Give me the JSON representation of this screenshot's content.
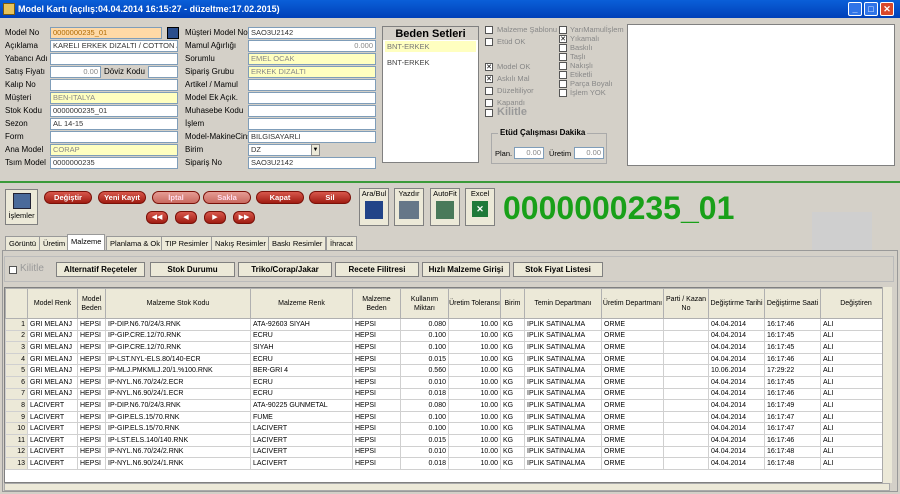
{
  "window": {
    "title": "Model Kartı (açılış:04.04.2014 16:15:27 - düzeltme:17.02.2015)"
  },
  "left_fields": [
    {
      "label": "Model No",
      "value": "0000000235_01",
      "style": "o"
    },
    {
      "label": "Açıklama",
      "value": "KARELI ERKEK DIZALTI / COTTON /",
      "style": "w"
    },
    {
      "label": "Yabancı Adı",
      "value": "",
      "style": "w"
    },
    {
      "label": "Satış Fiyatı",
      "value": "0.00",
      "style": "r"
    },
    {
      "label": "Kalıp No",
      "value": "",
      "style": "w"
    },
    {
      "label": "Müşteri",
      "value": "BEN-ITALYA",
      "style": "y"
    },
    {
      "label": "Stok Kodu",
      "value": "0000000235_01",
      "style": "w"
    },
    {
      "label": "Sezon",
      "value": "AL 14-15",
      "style": "w"
    },
    {
      "label": "Form",
      "value": "",
      "style": "w"
    },
    {
      "label": "Ana Model",
      "value": "CORAP",
      "style": "y"
    },
    {
      "label": "Tsım Model",
      "value": "0000000235",
      "style": "w"
    }
  ],
  "doviz_kodu_label": "Döviz Kodu",
  "mid_fields": [
    {
      "label": "Müşteri Model No",
      "value": "SAO3U2142",
      "style": "w"
    },
    {
      "label": "Mamul Ağırlığı",
      "value": "0.000",
      "style": "r"
    },
    {
      "label": "Sorumlu",
      "value": "EMEL OCAK",
      "style": "y"
    },
    {
      "label": "Sipariş Grubu",
      "value": "ERKEK DIZALTI",
      "style": "y"
    },
    {
      "label": "Artikel / Mamul",
      "value": "",
      "style": "w"
    },
    {
      "label": "Model Ek Açık.",
      "value": "",
      "style": "w"
    },
    {
      "label": "Muhasebe Kodu",
      "value": "",
      "style": "w"
    },
    {
      "label": "İşlem",
      "value": "",
      "style": "w"
    },
    {
      "label": "Model-MakineCinsi",
      "value": "BILGISAYARLI",
      "style": "w"
    },
    {
      "label": "Birim",
      "value": "DZ",
      "style": "w"
    },
    {
      "label": "Sipariş No",
      "value": "SAO3U2142",
      "style": "w"
    }
  ],
  "beden": {
    "title": "Beden Setleri",
    "selected": "BNT-ERKEK",
    "items": [
      "BNT-ERKEK"
    ]
  },
  "checks_left": [
    {
      "label": "Malzeme Şablonu",
      "checked": false
    },
    {
      "label": "Etüd OK",
      "checked": false
    },
    {
      "label": "Model OK",
      "checked": true
    },
    {
      "label": "Askılı Mal",
      "checked": true
    },
    {
      "label": "Düzeltiliyor",
      "checked": false
    },
    {
      "label": "Kapandı",
      "checked": false
    }
  ],
  "kilitle_label": "Kilitle",
  "checks_right": [
    {
      "label": "YarıMamulİşlem",
      "checked": false
    },
    {
      "label": "Yıkamalı",
      "checked": true
    },
    {
      "label": "Baskılı",
      "checked": false
    },
    {
      "label": "Taşlı",
      "checked": false
    },
    {
      "label": "Nakışlı",
      "checked": false
    },
    {
      "label": "Etiketli",
      "checked": false
    },
    {
      "label": "Parça Boyalı",
      "checked": false
    },
    {
      "label": "İşlem YOK",
      "checked": false
    }
  ],
  "etud": {
    "title": "Etüd Çalışması Dakika",
    "plan_label": "Plan.",
    "plan_value": "0.00",
    "uretim_label": "Üretim",
    "uretim_value": "0.00"
  },
  "toolbar": {
    "islemler": "İşlemler",
    "buttons": [
      "Değiştir",
      "Yeni Kayıt",
      "İptal",
      "Sakla",
      "Kapat",
      "Sil"
    ],
    "nav": [
      "◀◀",
      "◀",
      "▶",
      "▶▶"
    ],
    "ara_bul": "Ara/Bul",
    "yazdir": "Yazdır",
    "autofit": "AutoFit",
    "excel": "Excel"
  },
  "big_code": "0000000235_01",
  "tabs": [
    "Görüntü",
    "Üretim",
    "Malzeme",
    "Planlama & Ok",
    "TIP Resimler",
    "Nakış Resimler",
    "Baskı Resimler",
    "İhracat"
  ],
  "active_tab": "Malzeme",
  "sub_buttons": [
    "Alternatif Reçeteler",
    "Stok Durumu",
    "Triko/Corap/Jakar",
    "Recete Filitresi",
    "Hızlı Malzeme Girişi",
    "Stok Fiyat Listesi"
  ],
  "sub_kilitle": "Kilitle",
  "grid": {
    "columns": [
      "",
      "Model Renk",
      "Model Beden",
      "Malzeme Stok Kodu",
      "Malzeme Renk",
      "Malzeme Beden",
      "Kullanım Miktarı",
      "Üretim Toleransı",
      "Birim",
      "Temin Departmanı",
      "Üretim Departmanı",
      "Parti / Kazan No",
      "Değiştirme Tarihi",
      "Değiştirme Saati",
      "Değiştiren"
    ],
    "rows": [
      [
        "1",
        "GRI MELANJ",
        "HEPSI",
        "IP-DIP.N6.70/24/3.RNK",
        "ATA-92603 SIYAH",
        "HEPSI",
        "0.080",
        "10.00",
        "KG",
        "IPLIK SATINALMA",
        "ORME",
        "",
        "04.04.2014",
        "16:17:46",
        "ALI"
      ],
      [
        "2",
        "GRI MELANJ",
        "HEPSI",
        "IP-GIP.CRE.12/70.RNK",
        "ECRU",
        "HEPSI",
        "0.100",
        "10.00",
        "KG",
        "IPLIK SATINALMA",
        "ORME",
        "",
        "04.04.2014",
        "16:17:45",
        "ALI"
      ],
      [
        "3",
        "GRI MELANJ",
        "HEPSI",
        "IP-GIP.CRE.12/70.RNK",
        "SIYAH",
        "HEPSI",
        "0.100",
        "10.00",
        "KG",
        "IPLIK SATINALMA",
        "ORME",
        "",
        "04.04.2014",
        "16:17:45",
        "ALI"
      ],
      [
        "4",
        "GRI MELANJ",
        "HEPSI",
        "IP-LST.NYL-ELS.80/140-ECR",
        "ECRU",
        "HEPSI",
        "0.015",
        "10.00",
        "KG",
        "IPLIK SATINALMA",
        "ORME",
        "",
        "04.04.2014",
        "16:17:46",
        "ALI"
      ],
      [
        "5",
        "GRI MELANJ",
        "HEPSI",
        "IP-MLJ.PMKMLJ.20/1.%100.RNK",
        "BER-GRI 4",
        "HEPSI",
        "0.560",
        "10.00",
        "KG",
        "IPLIK SATINALMA",
        "ORME",
        "",
        "10.06.2014",
        "17:29:22",
        "ALI"
      ],
      [
        "6",
        "GRI MELANJ",
        "HEPSI",
        "IP-NYL.N6.70/24/2.ECR",
        "ECRU",
        "HEPSI",
        "0.010",
        "10.00",
        "KG",
        "IPLIK SATINALMA",
        "ORME",
        "",
        "04.04.2014",
        "16:17:45",
        "ALI"
      ],
      [
        "7",
        "GRI MELANJ",
        "HEPSI",
        "IP-NYL.N6.90/24/1.ECR",
        "ECRU",
        "HEPSI",
        "0.018",
        "10.00",
        "KG",
        "IPLIK SATINALMA",
        "ORME",
        "",
        "04.04.2014",
        "16:17:46",
        "ALI"
      ],
      [
        "8",
        "LACIVERT",
        "HEPSI",
        "IP-DIP.N6.70/24/3.RNK",
        "ATA-90225 GUNMETAL",
        "HEPSI",
        "0.080",
        "10.00",
        "KG",
        "IPLIK SATINALMA",
        "ORME",
        "",
        "04.04.2014",
        "16:17:49",
        "ALI"
      ],
      [
        "9",
        "LACIVERT",
        "HEPSI",
        "IP-GIP.ELS.15/70.RNK",
        "FUME",
        "HEPSI",
        "0.100",
        "10.00",
        "KG",
        "IPLIK SATINALMA",
        "ORME",
        "",
        "04.04.2014",
        "16:17:47",
        "ALI"
      ],
      [
        "10",
        "LACIVERT",
        "HEPSI",
        "IP-GIP.ELS.15/70.RNK",
        "LACIVERT",
        "HEPSI",
        "0.100",
        "10.00",
        "KG",
        "IPLIK SATINALMA",
        "ORME",
        "",
        "04.04.2014",
        "16:17:47",
        "ALI"
      ],
      [
        "11",
        "LACIVERT",
        "HEPSI",
        "IP-LST.ELS.140/140.RNK",
        "LACIVERT",
        "HEPSI",
        "0.015",
        "10.00",
        "KG",
        "IPLIK SATINALMA",
        "ORME",
        "",
        "04.04.2014",
        "16:17:46",
        "ALI"
      ],
      [
        "12",
        "LACIVERT",
        "HEPSI",
        "IP-NYL.N6.70/24/2.RNK",
        "LACIVERT",
        "HEPSI",
        "0.010",
        "10.00",
        "KG",
        "IPLIK SATINALMA",
        "ORME",
        "",
        "04.04.2014",
        "16:17:48",
        "ALI"
      ],
      [
        "13",
        "LACIVERT",
        "HEPSI",
        "IP-NYL.N6.90/24/1.RNK",
        "LACIVERT",
        "HEPSI",
        "0.018",
        "10.00",
        "KG",
        "IPLIK SATINALMA",
        "ORME",
        "",
        "04.04.2014",
        "16:17:48",
        "ALI"
      ]
    ]
  }
}
